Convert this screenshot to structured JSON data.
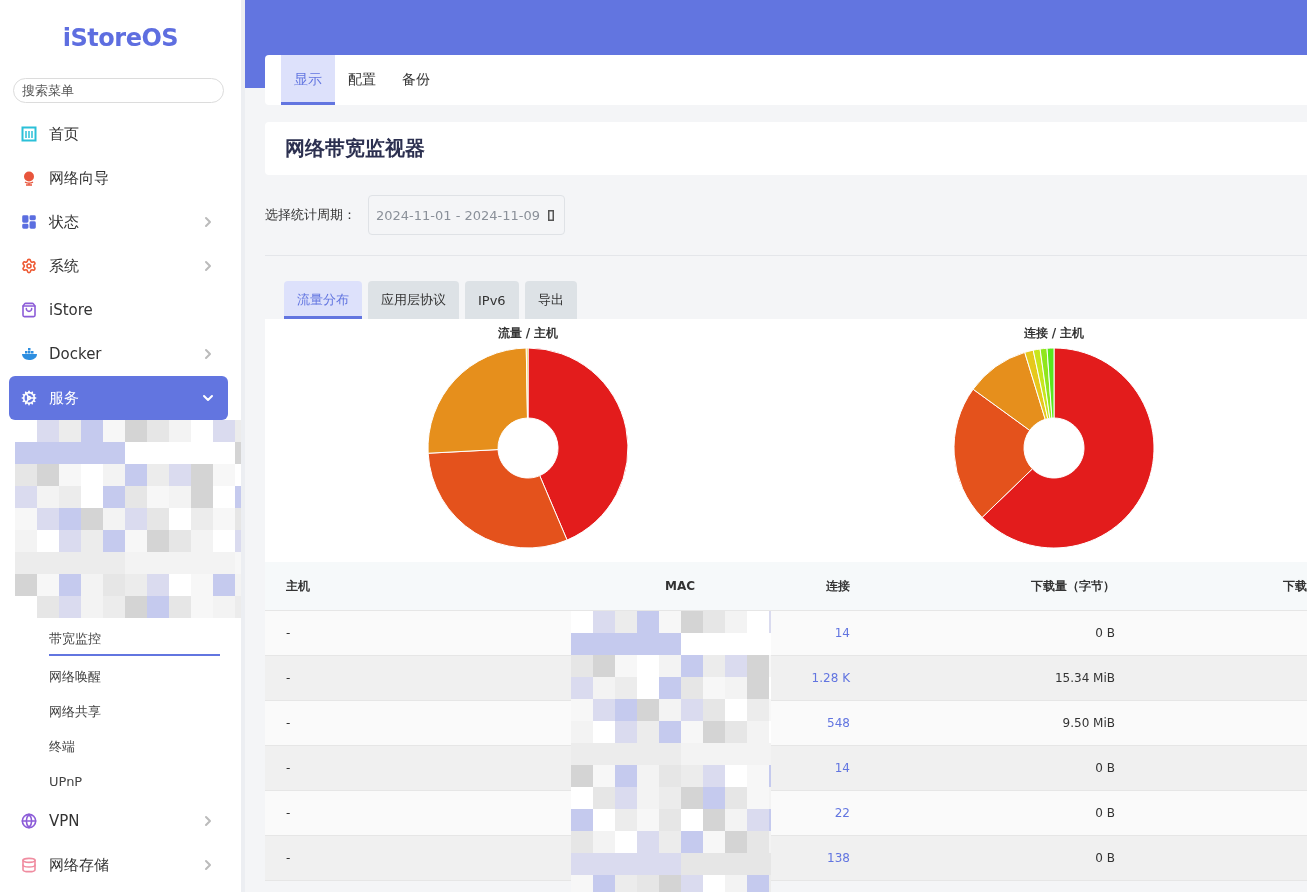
{
  "sidebar": {
    "logo": "iStoreOS",
    "search": {
      "placeholder": "搜索菜单"
    },
    "items": [
      {
        "kind": "link",
        "label": "首页",
        "selected": false
      },
      {
        "kind": "link",
        "label": "网络向导",
        "selected": false
      },
      {
        "kind": "group",
        "label": "状态",
        "expanded": false,
        "selected": false
      },
      {
        "kind": "group",
        "label": "系统",
        "expanded": false,
        "selected": false
      },
      {
        "kind": "link",
        "label": "iStore",
        "selected": false
      },
      {
        "kind": "group",
        "label": "Docker",
        "expanded": false,
        "selected": false
      },
      {
        "kind": "group",
        "label": "服务",
        "expanded": true,
        "selected": true,
        "children": [
          {
            "kind": "pixelated"
          },
          {
            "kind": "link",
            "label": "带宽监控",
            "selected": true
          },
          {
            "kind": "link",
            "label": "网络唤醒",
            "selected": false
          },
          {
            "kind": "link",
            "label": "网络共享",
            "selected": false
          },
          {
            "kind": "link",
            "label": "终端",
            "selected": false
          },
          {
            "kind": "link",
            "label": "UPnP",
            "selected": false
          }
        ]
      },
      {
        "kind": "group",
        "label": "VPN",
        "expanded": false,
        "selected": false
      },
      {
        "kind": "group",
        "label": "网络存储",
        "expanded": false,
        "selected": false
      }
    ]
  },
  "tabs": [
    {
      "label": "显示",
      "selected": true
    },
    {
      "label": "配置",
      "selected": false
    },
    {
      "label": "备份",
      "selected": false
    }
  ],
  "title": "网络带宽监视器",
  "period": {
    "label": "选择统计周期：",
    "value": "2024-11-01 - 2024-11-09"
  },
  "sub_tabs": [
    {
      "label": "流量分布",
      "selected": true
    },
    {
      "label": "应用层协议",
      "selected": false
    },
    {
      "label": "IPv6",
      "selected": false
    },
    {
      "label": "导出",
      "selected": false
    }
  ],
  "charts": [
    {
      "title": "流量 / 主机",
      "kind": "pie"
    },
    {
      "title": "连接 / 主机",
      "kind": "pie"
    }
  ],
  "table": {
    "columns": [
      "主机",
      "MAC",
      "连接",
      "下载量（字节）",
      "下载"
    ],
    "rows": [
      {
        "host": "-",
        "connections": "14",
        "download": "0 B"
      },
      {
        "host": "-",
        "connections": "1.28 K",
        "download": "15.34 MiB"
      },
      {
        "host": "-",
        "connections": "548",
        "download": "9.50 MiB"
      },
      {
        "host": "-",
        "connections": "14",
        "download": "0 B"
      },
      {
        "host": "-",
        "connections": "22",
        "download": "0 B"
      },
      {
        "host": "-",
        "connections": "138",
        "download": "0 B"
      }
    ]
  }
}
